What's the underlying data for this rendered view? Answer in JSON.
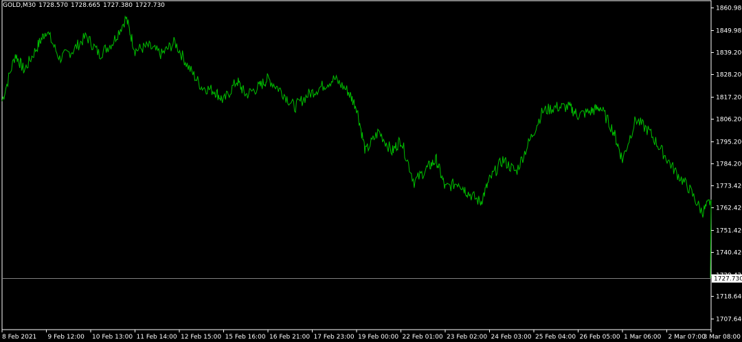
{
  "header": {
    "symbol": "GOLD,M30",
    "open": "1728.570",
    "high": "1728.665",
    "low": "1727.380",
    "close": "1727.730"
  },
  "colors": {
    "background": "#000000",
    "frame": "#ffffff",
    "line": "#00c000",
    "price_line": "#808080",
    "price_tag_bg": "#ffffff",
    "price_tag_text": "#000000",
    "text": "#ffffff"
  },
  "chart_data": {
    "type": "line",
    "title": "",
    "xlabel": "",
    "ylabel": "",
    "ylim": [
      1702.2,
      1864.5
    ],
    "grid": false,
    "y_ticks": [
      "1860.980",
      "1849.980",
      "1839.200",
      "1828.200",
      "1817.200",
      "1806.200",
      "1795.200",
      "1784.200",
      "1773.420",
      "1762.420",
      "1751.420",
      "1740.420",
      "1729.420",
      "1718.640",
      "1707.640"
    ],
    "x_ticks": [
      "8 Feb 2021",
      "9 Feb 12:00",
      "10 Feb 13:00",
      "11 Feb 14:00",
      "12 Feb 15:00",
      "15 Feb 16:00",
      "16 Feb 21:00",
      "17 Feb 23:00",
      "19 Feb 00:00",
      "22 Feb 01:00",
      "23 Feb 02:00",
      "24 Feb 03:00",
      "25 Feb 04:00",
      "26 Feb 05:00",
      "1 Mar 06:00",
      "2 Mar 07:00",
      "3 Mar 08:00"
    ],
    "current_price": 1727.73,
    "current_price_label": "1727.730",
    "series": [
      {
        "x_index": [
          0,
          0.3,
          0.5,
          0.8,
          1,
          1.3,
          1.6,
          1.9,
          2.2,
          2.5,
          2.8,
          3,
          3.3,
          3.6,
          3.9,
          4.2,
          4.5,
          4.8,
          5,
          5.3,
          5.5,
          5.8,
          6,
          6.3,
          6.6,
          6.9,
          7.2,
          7.5,
          7.8,
          8,
          8.2,
          8.5,
          8.8,
          9,
          9.3,
          9.6,
          9.8,
          10,
          10.3,
          10.5,
          10.8,
          11,
          11.3,
          11.6,
          11.9,
          12.2,
          12.5,
          12.8,
          13,
          13.3,
          13.5,
          13.8,
          14,
          14.3,
          14.6,
          14.9,
          15.2,
          15.5,
          15.8,
          16
        ],
        "values": [
          1815,
          1838,
          1830,
          1842,
          1850,
          1836,
          1840,
          1847,
          1838,
          1844,
          1856,
          1840,
          1842,
          1838,
          1844,
          1832,
          1822,
          1820,
          1815,
          1825,
          1818,
          1822,
          1826,
          1820,
          1812,
          1818,
          1822,
          1826,
          1820,
          1812,
          1790,
          1800,
          1790,
          1796,
          1775,
          1782,
          1786,
          1772,
          1775,
          1770,
          1765,
          1776,
          1786,
          1780,
          1795,
          1810,
          1812,
          1812,
          1808,
          1810,
          1812,
          1800,
          1786,
          1806,
          1800,
          1790,
          1780,
          1772,
          1760,
          1766
        ]
      }
    ]
  }
}
